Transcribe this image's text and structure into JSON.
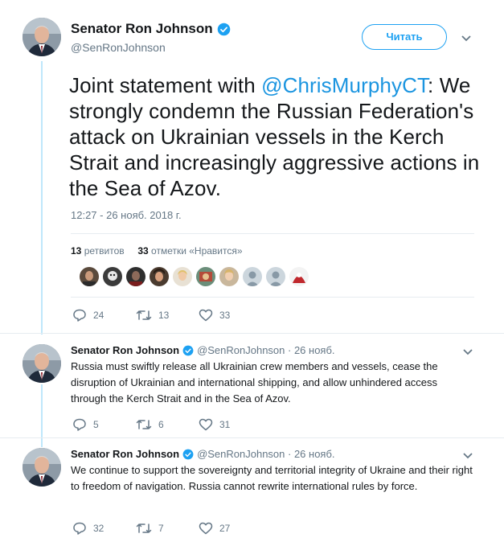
{
  "main": {
    "author_name": "Senator Ron Johnson",
    "author_handle": "@SenRonJohnson",
    "follow_label": "Читать",
    "text_before": "Joint statement with ",
    "mention": "@ChrisMurphyCT",
    "text_after": ": We strongly condemn the Russian Federation's attack on Ukrainian vessels in the Kerch Strait and increasingly aggressive actions in the Sea of Azov.",
    "timestamp": "12:27 - 26 нояб. 2018 г.",
    "retweets_count": "13",
    "retweets_label": "ретвитов",
    "likes_count": "33",
    "likes_label": "отметки «Нравится»",
    "replies": "24",
    "retweets": "13",
    "likes": "33"
  },
  "replies": [
    {
      "name": "Senator Ron Johnson",
      "meta": "@SenRonJohnson · 26 нояб.",
      "text": "Russia must swiftly release all Ukrainian crew members and vessels, cease the disruption of Ukrainian and international shipping, and allow unhindered access through the Kerch Strait and in the Sea of Azov.",
      "replies": "5",
      "retweets": "6",
      "likes": "31"
    },
    {
      "name": "Senator Ron Johnson",
      "meta": "@SenRonJohnson · 26 нояб.",
      "text": "We continue to support the sovereignty and territorial integrity of Ukraine and their right to freedom of navigation. Russia cannot rewrite international rules by force.",
      "replies": "32",
      "retweets": "7",
      "likes": "27"
    }
  ],
  "colors": {
    "accent": "#1da1f2",
    "mention": "#1b95e0",
    "muted": "#657786",
    "thread": "#bfe7fb"
  }
}
